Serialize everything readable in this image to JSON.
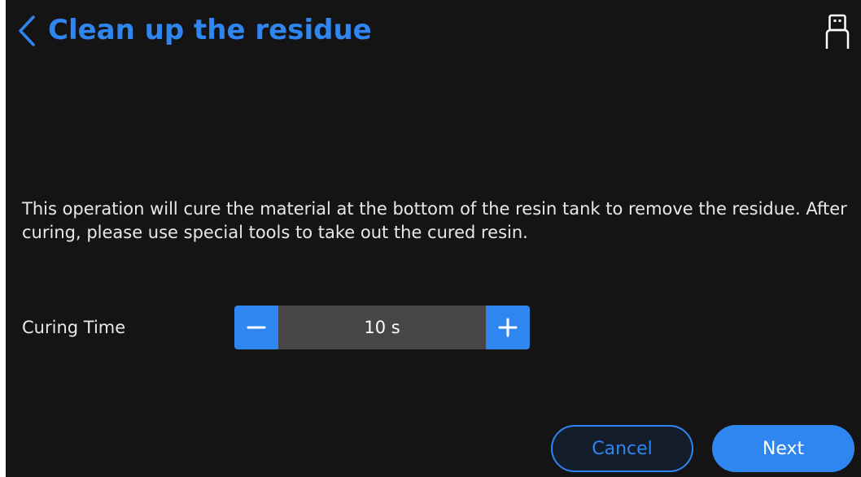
{
  "header": {
    "title": "Clean up the residue",
    "back_icon": "chevron-left-icon",
    "usb_icon": "usb-icon"
  },
  "main": {
    "description": "This operation will cure the material at the bottom of the resin tank to remove the residue. After curing, please use special tools to take out the cured resin.",
    "curing_time": {
      "label": "Curing Time",
      "value": "10 s",
      "decrement_icon": "minus-icon",
      "increment_icon": "plus-icon"
    }
  },
  "footer": {
    "cancel_label": "Cancel",
    "next_label": "Next"
  },
  "colors": {
    "accent": "#2f86f0",
    "background": "#141414",
    "stepper_track": "#464646",
    "text": "#e8e8e8"
  }
}
